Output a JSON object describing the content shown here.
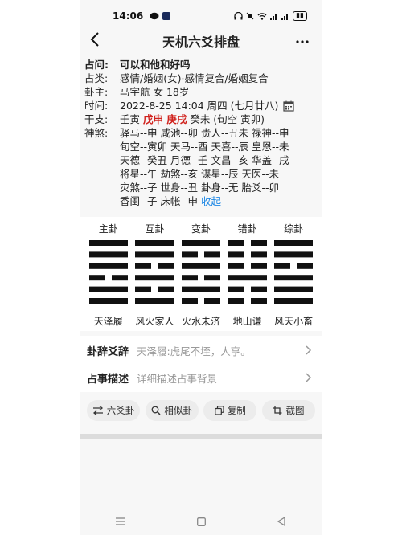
{
  "status": {
    "time": "14:06"
  },
  "nav": {
    "title": "天机六爻排盘"
  },
  "info": {
    "question_key": "占问:",
    "question": "可以和他和好吗",
    "category_key": "占类:",
    "category": "感情/婚姻(女)·感情复合/婚姻复合",
    "subject_key": "卦主:",
    "subject": "马宇航 女 18岁",
    "time_key": "时间:",
    "time": "2022-8-25 14:04 周四 (七月廿八)",
    "ganzhi_key": "干支:",
    "ganzhi_a": "壬寅 ",
    "ganzhi_b": "戊申 庚戌",
    "ganzhi_c": " 癸未 (旬空 寅卯)",
    "shensha_key": "神煞:",
    "shensha_lines": [
      "驿马--申 咸池--卯 贵人--丑未 禄神--申",
      "旬空--寅卯 天马--酉 天喜--辰 皇恩--未",
      "天德--癸丑 月德--壬 文昌--亥 华盖--戌",
      "将星--午 劫煞--亥 谋星--辰 天医--未",
      "灾煞--子 世身--丑 卦身--无 胎爻--卯"
    ],
    "shensha_last": "香闺--子 床帐--申 ",
    "collapse": "收起"
  },
  "gua": [
    {
      "label": "主卦",
      "name": "天泽履",
      "lines": [
        1,
        1,
        1,
        0,
        1,
        1
      ]
    },
    {
      "label": "互卦",
      "name": "风火家人",
      "lines": [
        1,
        1,
        0,
        1,
        0,
        1
      ]
    },
    {
      "label": "变卦",
      "name": "火水未济",
      "lines": [
        1,
        0,
        1,
        0,
        1,
        0
      ]
    },
    {
      "label": "错卦",
      "name": "地山谦",
      "lines": [
        0,
        0,
        0,
        1,
        0,
        0
      ]
    },
    {
      "label": "综卦",
      "name": "风天小畜",
      "lines": [
        1,
        1,
        0,
        1,
        1,
        1
      ]
    }
  ],
  "gua_ci": {
    "title": "卦辞爻辞",
    "text": "天泽履:虎尾不垤，人亨。"
  },
  "zhanshi": {
    "title": "占事描述",
    "placeholder": "详细描述占事背景"
  },
  "buttons": {
    "liuyao": "六爻卦",
    "similar": "相似卦",
    "copy": "复制",
    "screenshot": "截图"
  },
  "colors": {
    "accent_red": "#d0211c",
    "link_blue": "#1e88e5"
  }
}
